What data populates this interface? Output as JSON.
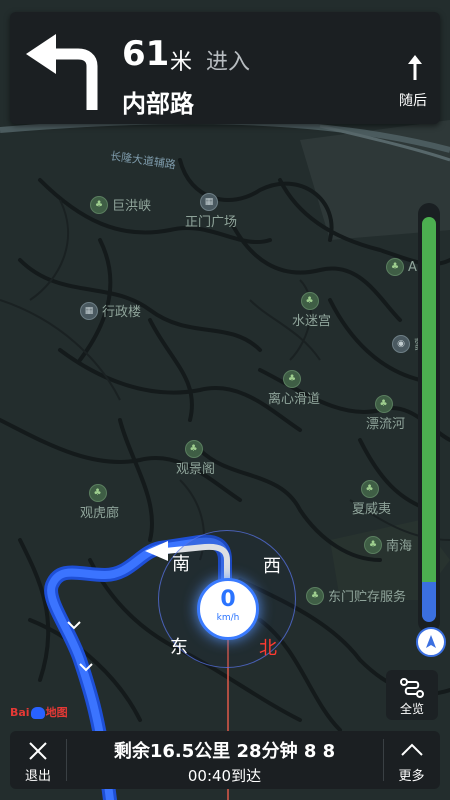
{
  "nav": {
    "distance": "61",
    "distance_unit": "米",
    "action": "进入",
    "road": "内部路",
    "next_label": "随后"
  },
  "map": {
    "road_label": "长隆大道辅路",
    "pois": [
      {
        "name": "巨洪峡"
      },
      {
        "name": "正门广场"
      },
      {
        "name": "行政楼"
      },
      {
        "name": "水迷宫"
      },
      {
        "name": "离心滑道"
      },
      {
        "name": "漂流河"
      },
      {
        "name": "观景阁"
      },
      {
        "name": "观虎廊"
      },
      {
        "name": "夏威夷"
      },
      {
        "name": "南海"
      },
      {
        "name": "东门贮存服务"
      },
      {
        "name": "A"
      },
      {
        "name": "蒙"
      }
    ]
  },
  "compass": {
    "south": "南",
    "west": "西",
    "east": "东",
    "north": "北"
  },
  "speed": {
    "value": "0",
    "unit": "km/h"
  },
  "progress": {
    "completed_fraction": 0.1
  },
  "overview": {
    "label": "全览"
  },
  "logo": {
    "text_left": "Bai",
    "text_right": "地图"
  },
  "bottom": {
    "exit_label": "退出",
    "remaining": "剩余16.5公里 28分钟 8 8",
    "arrival": "00:40到达",
    "more_label": "更多"
  },
  "colors": {
    "accent_blue": "#3b6fe0",
    "route_green": "#4caf50",
    "north_red": "#ff3b30"
  }
}
